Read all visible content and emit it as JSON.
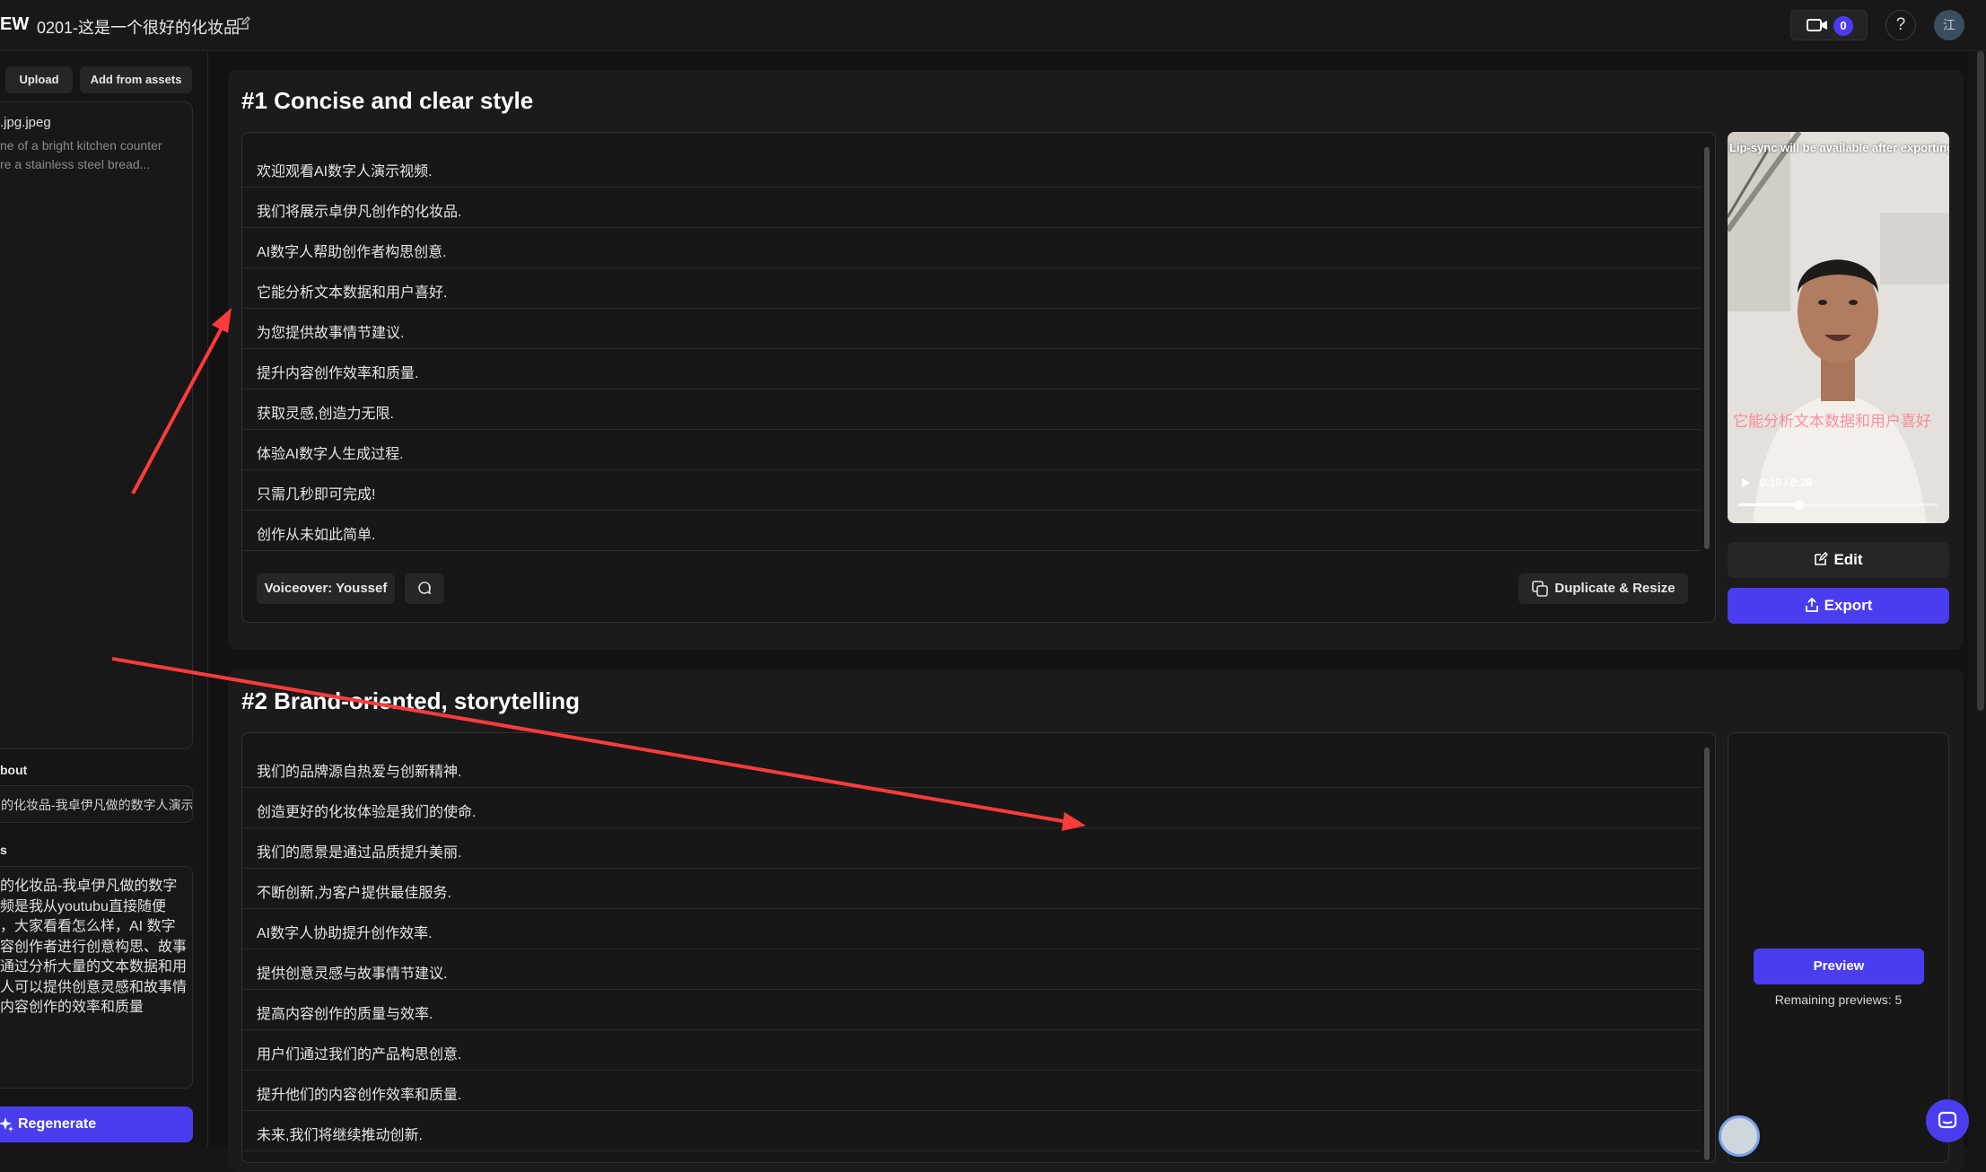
{
  "header": {
    "brand": "EW",
    "project_title": "0201-这是一个很好的化妆品",
    "record_count": "0",
    "help_label": "?",
    "avatar_initial": "江"
  },
  "sidebar": {
    "upload_label": "Upload",
    "add_assets_label": "Add from assets",
    "asset_name": ".jpg.jpeg",
    "asset_desc_lines": [
      "ne of a bright kitchen counter",
      "re a stainless steel bread..."
    ],
    "about_label": "bout",
    "about_value": "的化妆品-我卓伊凡做的数字人演示",
    "script_label": "s",
    "script_lines": [
      "的化妆品-我卓伊凡做的数字",
      "频是我从youtubu直接随便",
      "，大家看看怎么样，AI 数字",
      "容创作者进行创意构思、故事",
      "通过分析大量的文本数据和用",
      "人可以提供创意灵感和故事情",
      "内容创作的效率和质量"
    ],
    "regenerate_label": "Regenerate"
  },
  "scripts": [
    {
      "title": "#1 Concise and clear style",
      "lines": [
        "欢迎观看AI数字人演示视频.",
        "我们将展示卓伊凡创作的化妆品.",
        "AI数字人帮助创作者构思创意.",
        "它能分析文本数据和用户喜好.",
        "为您提供故事情节建议.",
        "提升内容创作效率和质量.",
        "获取灵感,创造力无限.",
        "体验AI数字人生成过程.",
        "只需几秒即可完成!",
        "创作从未如此简单."
      ],
      "voiceover_label": "Voiceover: Youssef",
      "duplicate_label": "Duplicate & Resize",
      "video": {
        "tip": "Lip-sync will be available after exporting",
        "time": "0:10 / 0:28",
        "progress": 0.3,
        "caption": "它能分析文本数据和用户喜好"
      },
      "edit_label": "Edit",
      "export_label": "Export"
    },
    {
      "title": "#2 Brand-oriented, storytelling",
      "lines": [
        "我们的品牌源自热爱与创新精神.",
        "创造更好的化妆体验是我们的使命.",
        "我们的愿景是通过品质提升美丽.",
        "不断创新,为客户提供最佳服务.",
        "AI数字人协助提升创作效率.",
        "提供创意灵感与故事情节建议.",
        "提高内容创作的质量与效率.",
        "用户们通过我们的产品构思创意.",
        "提升他们的内容创作效率和质量.",
        "未来,我们将继续推动创新."
      ],
      "preview_label": "Preview",
      "remaining_label": "Remaining previews: 5"
    }
  ],
  "colors": {
    "accent": "#4a3df0",
    "annotation": "#ff3b3b",
    "bg": "#121212"
  },
  "icons": [
    "edit-icon",
    "video-camera-icon",
    "help-icon",
    "sparkle-icon",
    "speech-icon",
    "duplicate-icon",
    "export-icon",
    "play-icon",
    "chat-icon"
  ]
}
